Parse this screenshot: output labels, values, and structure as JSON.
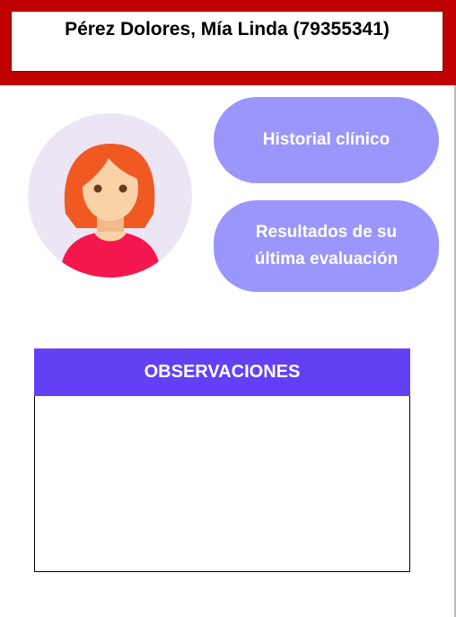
{
  "header": {
    "patient_name": "Pérez Dolores, Mía Linda (79355341)"
  },
  "avatar": {
    "icon": "female-patient-avatar-icon"
  },
  "buttons": {
    "historial_label": "Historial clínico",
    "resultados_line1": "Resultados de su",
    "resultados_line2": "última evaluación"
  },
  "observations": {
    "title": "OBSERVACIONES",
    "content": ""
  },
  "colors": {
    "header_bar": "#c00000",
    "button_fill": "#9a96fb",
    "observations_header": "#6440f5",
    "avatar_background": "#ebe5f4",
    "hair": "#f05a22",
    "skin": "#fad2a7",
    "shirt": "#f3174e"
  }
}
